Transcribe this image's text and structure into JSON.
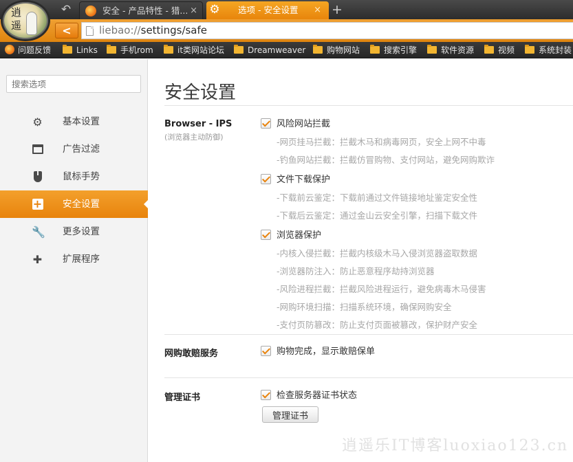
{
  "avatar": {
    "glyph": "逍遥"
  },
  "tabs": [
    {
      "title": "安全 - 产品特性 - 猎...",
      "close": "×",
      "active": false
    },
    {
      "title": "选项 - 安全设置",
      "close": "×",
      "active": true,
      "icon": "gear-icon"
    }
  ],
  "new_tab_label": "+",
  "navbar": {
    "back_label": "<",
    "url_scheme": "liebao://",
    "url_path": "settings/safe"
  },
  "bookmarks": [
    {
      "label": "问题反馈",
      "icon": "liebao-icon"
    },
    {
      "label": "Links",
      "icon": "folder-icon"
    },
    {
      "label": "手机rom",
      "icon": "folder-icon"
    },
    {
      "label": "it类网站论坛",
      "icon": "folder-icon"
    },
    {
      "label": "Dreamweaver",
      "icon": "folder-icon"
    },
    {
      "label": "购物网站",
      "icon": "folder-icon"
    },
    {
      "label": "搜索引擎",
      "icon": "folder-icon"
    },
    {
      "label": "软件资源",
      "icon": "folder-icon"
    },
    {
      "label": "视频",
      "icon": "folder-icon"
    },
    {
      "label": "系统封装",
      "icon": "folder-icon"
    }
  ],
  "sidebar": {
    "search_placeholder": "搜索选项",
    "items": [
      {
        "label": "基本设置",
        "icon": "gear-icon",
        "active": false
      },
      {
        "label": "广告过滤",
        "icon": "window-icon",
        "active": false
      },
      {
        "label": "鼠标手势",
        "icon": "mouse-icon",
        "active": false
      },
      {
        "label": "安全设置",
        "icon": "plus-shield-icon",
        "active": true
      },
      {
        "label": "更多设置",
        "icon": "wrench-icon",
        "active": false
      },
      {
        "label": "扩展程序",
        "icon": "puzzle-icon",
        "active": false
      }
    ]
  },
  "main": {
    "title": "安全设置",
    "ips": {
      "title": "Browser - IPS",
      "subtitle": "(浏览器主动防御)",
      "options": [
        {
          "label": "风险网站拦截",
          "checked": true,
          "details": [
            "-网页挂马拦截：拦截木马和病毒网页，安全上网不中毒",
            "-钓鱼网站拦截：拦截仿冒购物、支付网站，避免网购欺诈"
          ]
        },
        {
          "label": "文件下载保护",
          "checked": true,
          "details": [
            "-下载前云鉴定：下载前通过文件链接地址鉴定安全性",
            "-下载后云鉴定：通过金山云安全引擎，扫描下载文件"
          ]
        },
        {
          "label": "浏览器保护",
          "checked": true,
          "details": [
            "-内核入侵拦截：拦截内核级木马入侵浏览器盗取数据",
            "-浏览器防注入：防止恶意程序劫持浏览器",
            "-风险进程拦截：拦截风险进程运行，避免病毒木马侵害",
            "-网购环境扫描：扫描系统环境，确保网购安全",
            "-支付页防篡改：防止支付页面被篡改，保护财产安全"
          ]
        }
      ]
    },
    "shopping": {
      "title": "网购敢赔服务",
      "option": {
        "label": "购物完成，显示敢赔保单",
        "checked": true
      }
    },
    "certs": {
      "title": "管理证书",
      "option": {
        "label": "检查服务器证书状态",
        "checked": true
      },
      "button": "管理证书"
    }
  },
  "watermark": "逍遥乐IT博客luoxiao123.cn",
  "colors": {
    "accent": "#e8830c",
    "tab_active": "#f5a623",
    "toolbar_dark": "#2c2c2c"
  }
}
